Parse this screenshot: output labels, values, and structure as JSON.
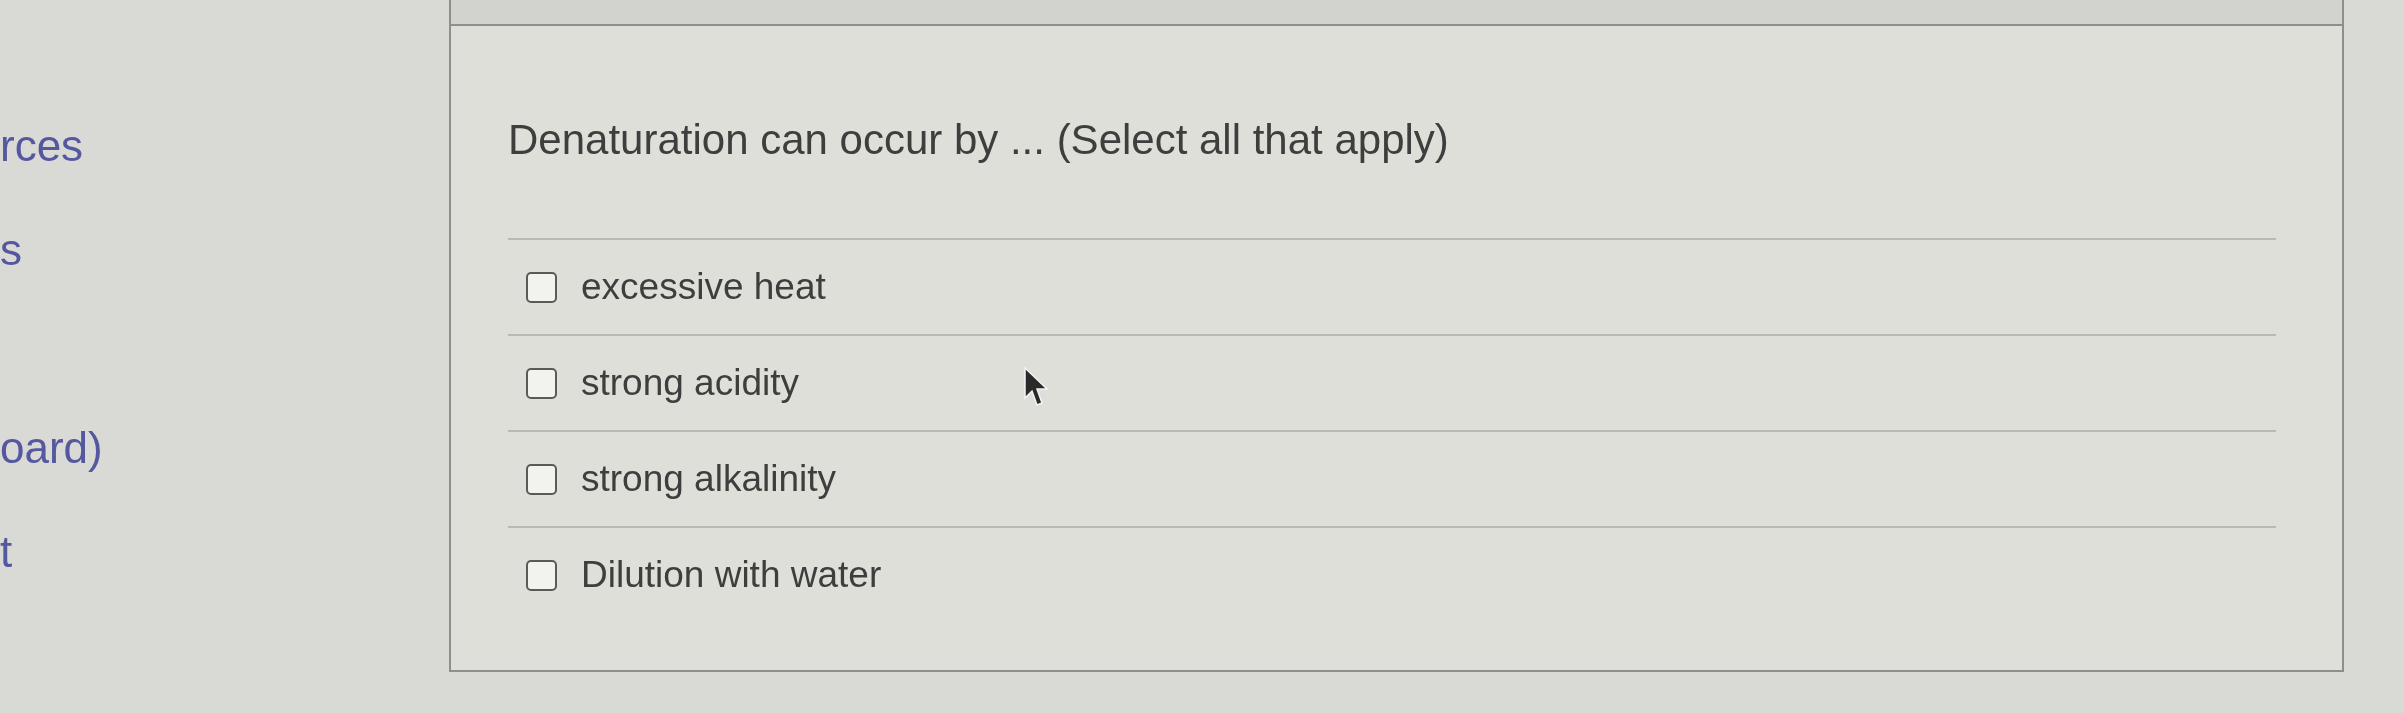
{
  "sidebar": {
    "items": [
      {
        "label": "rces"
      },
      {
        "label": "s"
      },
      {
        "label": "oard)"
      },
      {
        "label": "t"
      }
    ]
  },
  "question": {
    "prompt": "Denaturation can occur by ... (Select all that apply)",
    "options": [
      {
        "label": "excessive heat",
        "checked": false
      },
      {
        "label": "strong acidity",
        "checked": false
      },
      {
        "label": "strong alkalinity",
        "checked": false
      },
      {
        "label": "Dilution with water",
        "checked": false
      }
    ]
  }
}
